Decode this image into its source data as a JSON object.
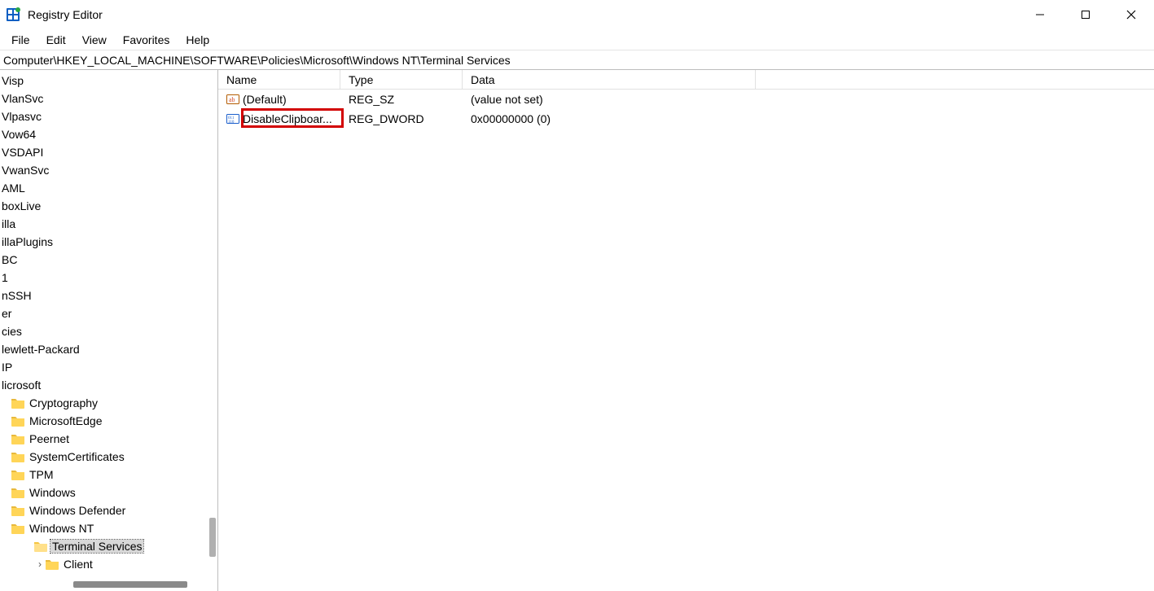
{
  "window": {
    "title": "Registry Editor"
  },
  "menu": {
    "file": "File",
    "edit": "Edit",
    "view": "View",
    "favorites": "Favorites",
    "help": "Help"
  },
  "path": "Computer\\HKEY_LOCAL_MACHINE\\SOFTWARE\\Policies\\Microsoft\\Windows NT\\Terminal Services",
  "tree": {
    "items": [
      {
        "label": "Visp",
        "indent": 0,
        "folder": false
      },
      {
        "label": "VlanSvc",
        "indent": 0,
        "folder": false
      },
      {
        "label": "Vlpasvc",
        "indent": 0,
        "folder": false
      },
      {
        "label": "Vow64",
        "indent": 0,
        "folder": false
      },
      {
        "label": "VSDAPI",
        "indent": 0,
        "folder": false
      },
      {
        "label": "VwanSvc",
        "indent": 0,
        "folder": false
      },
      {
        "label": "AML",
        "indent": 0,
        "folder": false
      },
      {
        "label": "boxLive",
        "indent": 0,
        "folder": false
      },
      {
        "label": "illa",
        "indent": 0,
        "folder": false
      },
      {
        "label": "illaPlugins",
        "indent": 0,
        "folder": false
      },
      {
        "label": "BC",
        "indent": 0,
        "folder": false
      },
      {
        "label": "1",
        "indent": 0,
        "folder": false
      },
      {
        "label": "nSSH",
        "indent": 0,
        "folder": false
      },
      {
        "label": "er",
        "indent": 0,
        "folder": false
      },
      {
        "label": "cies",
        "indent": 0,
        "folder": false
      },
      {
        "label": "lewlett-Packard",
        "indent": 0,
        "folder": false
      },
      {
        "label": "IP",
        "indent": 0,
        "folder": false
      },
      {
        "label": "licrosoft",
        "indent": 0,
        "folder": false
      },
      {
        "label": "Cryptography",
        "indent": 1,
        "folder": true
      },
      {
        "label": "MicrosoftEdge",
        "indent": 1,
        "folder": true
      },
      {
        "label": "Peernet",
        "indent": 1,
        "folder": true
      },
      {
        "label": "SystemCertificates",
        "indent": 1,
        "folder": true
      },
      {
        "label": "TPM",
        "indent": 1,
        "folder": true
      },
      {
        "label": "Windows",
        "indent": 1,
        "folder": true
      },
      {
        "label": "Windows Defender",
        "indent": 1,
        "folder": true
      },
      {
        "label": "Windows NT",
        "indent": 1,
        "folder": true
      },
      {
        "label": "Terminal Services",
        "indent": 2,
        "folder": true,
        "selected": true,
        "open": true
      },
      {
        "label": "Client",
        "indent": 3,
        "folder": true,
        "arrow": ">"
      }
    ]
  },
  "list": {
    "columns": {
      "name": "Name",
      "type": "Type",
      "data": "Data"
    },
    "rows": [
      {
        "icon": "sz",
        "name": "(Default)",
        "type": "REG_SZ",
        "data": "(value not set)"
      },
      {
        "icon": "dword",
        "name": "DisableClipboar...",
        "type": "REG_DWORD",
        "data": "0x00000000 (0)",
        "highlight": true
      }
    ]
  }
}
